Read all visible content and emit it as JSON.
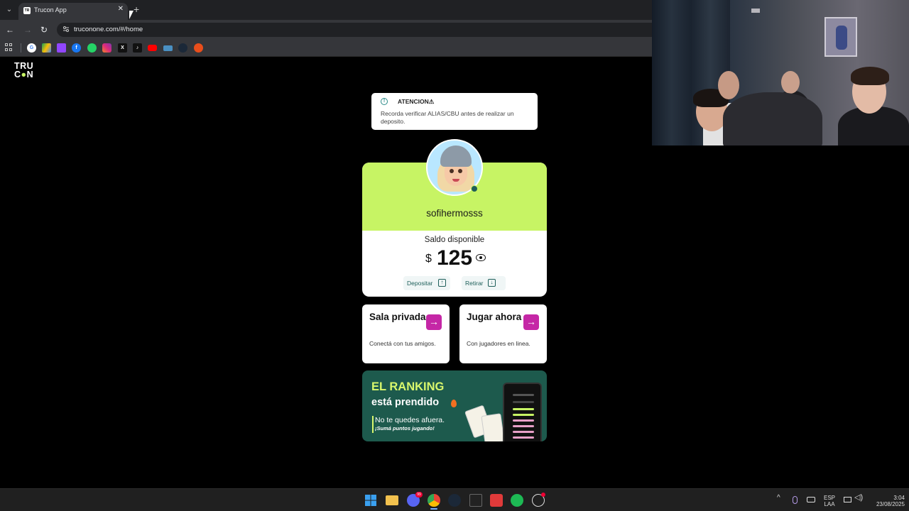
{
  "browser": {
    "tab_title": "Trucon App",
    "tab_favicon_text": "TR",
    "url": "truconone.com/#/home",
    "bookmarks": [
      "google-icon",
      "drive-icon",
      "twitch-icon",
      "facebook-icon",
      "whatsapp-icon",
      "instagram-icon",
      "x-icon",
      "tiktok-icon",
      "youtube-icon",
      "pc-icon",
      "steam-icon",
      "apple-icon"
    ]
  },
  "app": {
    "logo_line1": "TRU",
    "logo_line2_a": "C",
    "logo_line2_b": "N",
    "alert": {
      "title": "ATENCION⚠",
      "text": "Recorda verificar ALIAS/CBU antes de realizar un deposito."
    },
    "profile": {
      "username": "sofihermosss",
      "balance_label": "Saldo disponible",
      "currency": "$",
      "balance": "125",
      "deposit_label": "Depositar",
      "withdraw_label": "Retirar"
    },
    "cards": [
      {
        "title": "Sala privada",
        "subtitle": "Conectá con tus amigos."
      },
      {
        "title": "Jugar ahora",
        "subtitle": "Con jugadores en linea."
      }
    ],
    "banner": {
      "title": "EL RANKING",
      "subtitle": "está prendido",
      "text1": "No te quedes afuera.",
      "text2": "¡Sumá puntos jugando!"
    }
  },
  "taskbar": {
    "language_top": "ESP",
    "language_bottom": "LAA",
    "time": "3:04",
    "date": "23/08/2025",
    "discord_badge": "99"
  },
  "colors": {
    "accent_lime": "#c7f464",
    "accent_magenta": "#c527a6",
    "banner_green": "#1d5a4d"
  }
}
